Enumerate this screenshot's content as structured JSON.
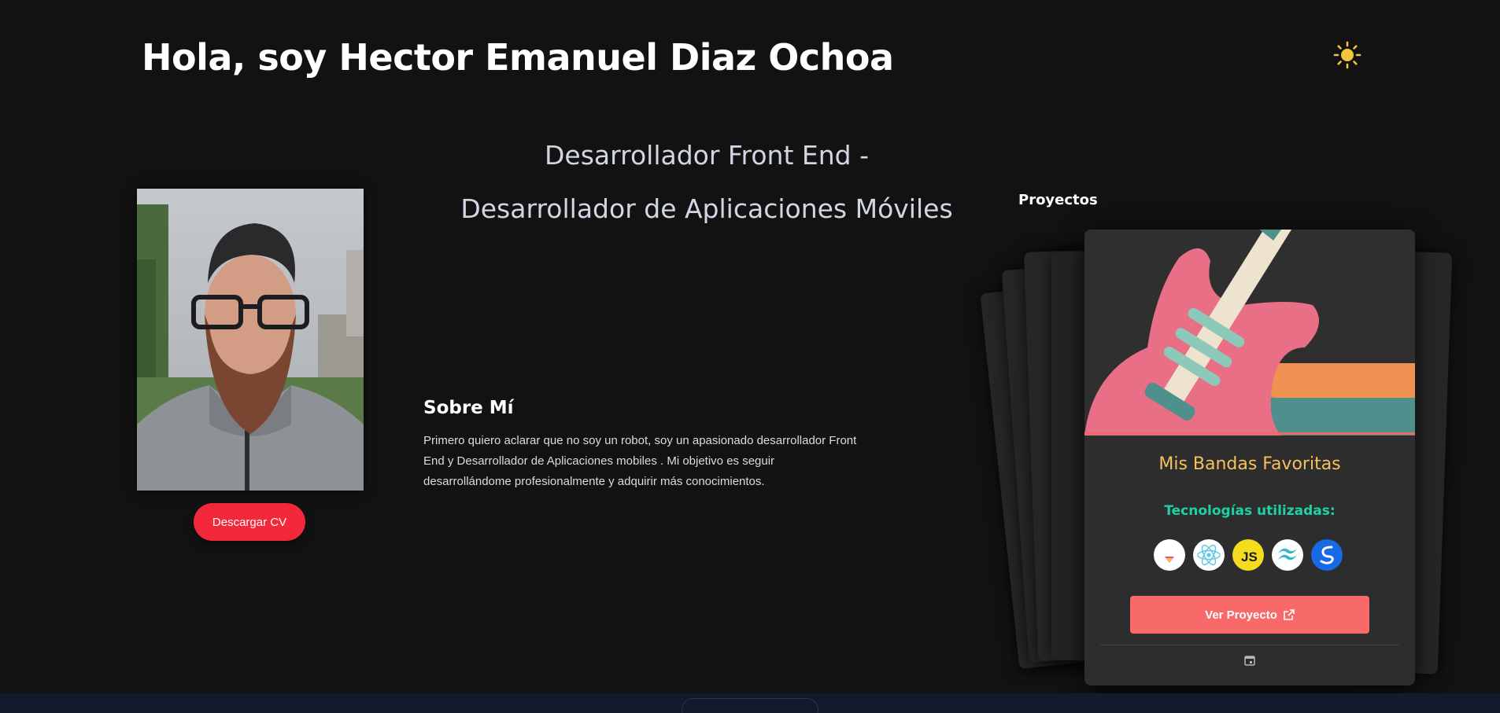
{
  "header": {
    "title": "Hola, soy Hector Emanuel Diaz Ochoa"
  },
  "theme_toggle": {
    "icon": "sun-icon",
    "color": "#f6c33c"
  },
  "roles": {
    "line1": "Desarrollador Front End -",
    "line2": "Desarrollador de Aplicaciones Móviles"
  },
  "profile": {
    "cv_button_label": "Descargar CV"
  },
  "about": {
    "title": "Sobre Mí",
    "line1": "Primero quiero aclarar que no soy un robot, soy un apasionado desarrollador Front",
    "line2": "End y Desarrollador de Aplicaciones mobiles . Mi objetivo es seguir",
    "line3": "desarrollándome profesionalmente y adquirir más conocimientos."
  },
  "projects": {
    "label": "Proyectos",
    "card": {
      "title": "Mis Bandas Favoritas",
      "tech_label": "Tecnologías utilizadas:",
      "technologies": [
        "vite-icon",
        "react-icon",
        "javascript-icon",
        "tailwind-icon",
        "styled-icon"
      ],
      "button_label": "Ver Proyecto",
      "button_icon": "external-link-icon",
      "footer_icon": "calendar-icon"
    }
  },
  "colors": {
    "background": "#121212",
    "accent_red": "#f4283b",
    "card_button": "#f8696a",
    "card_title": "#f6c05a",
    "tech_label": "#1ed1a6"
  }
}
